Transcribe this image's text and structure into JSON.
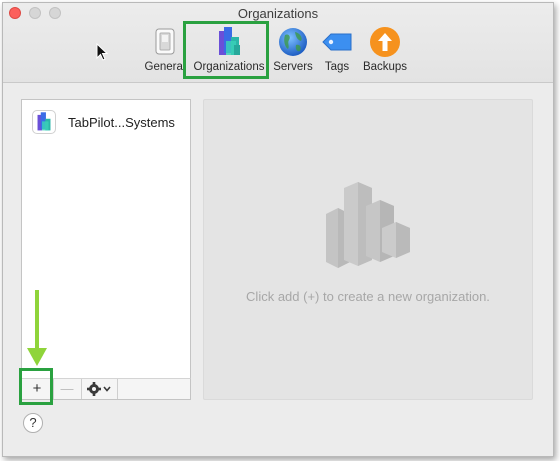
{
  "window": {
    "title": "Organizations"
  },
  "toolbar": {
    "items": [
      {
        "label": "General",
        "icon": "switch-icon"
      },
      {
        "label": "Organizations",
        "icon": "organizations-icon",
        "selected": true
      },
      {
        "label": "Servers",
        "icon": "globe-icon"
      },
      {
        "label": "Tags",
        "icon": "tag-icon"
      },
      {
        "label": "Backups",
        "icon": "backup-arrow-icon"
      }
    ]
  },
  "sidebar": {
    "items": [
      {
        "label": "TabPilot...Systems",
        "icon": "organizations-icon"
      }
    ],
    "bar": {
      "add_label": "+",
      "remove_label": "—",
      "actions_icon": "gear-icon"
    }
  },
  "detail": {
    "empty_text": "Click add (+) to create a new organization."
  },
  "help": {
    "label": "?"
  },
  "colors": {
    "highlight": "#2aa140",
    "arrow": "#8fd43a",
    "close": "#fc605c",
    "globe": "#2f7fe0",
    "tag": "#3c8ff0",
    "backups": "#f6921e"
  }
}
